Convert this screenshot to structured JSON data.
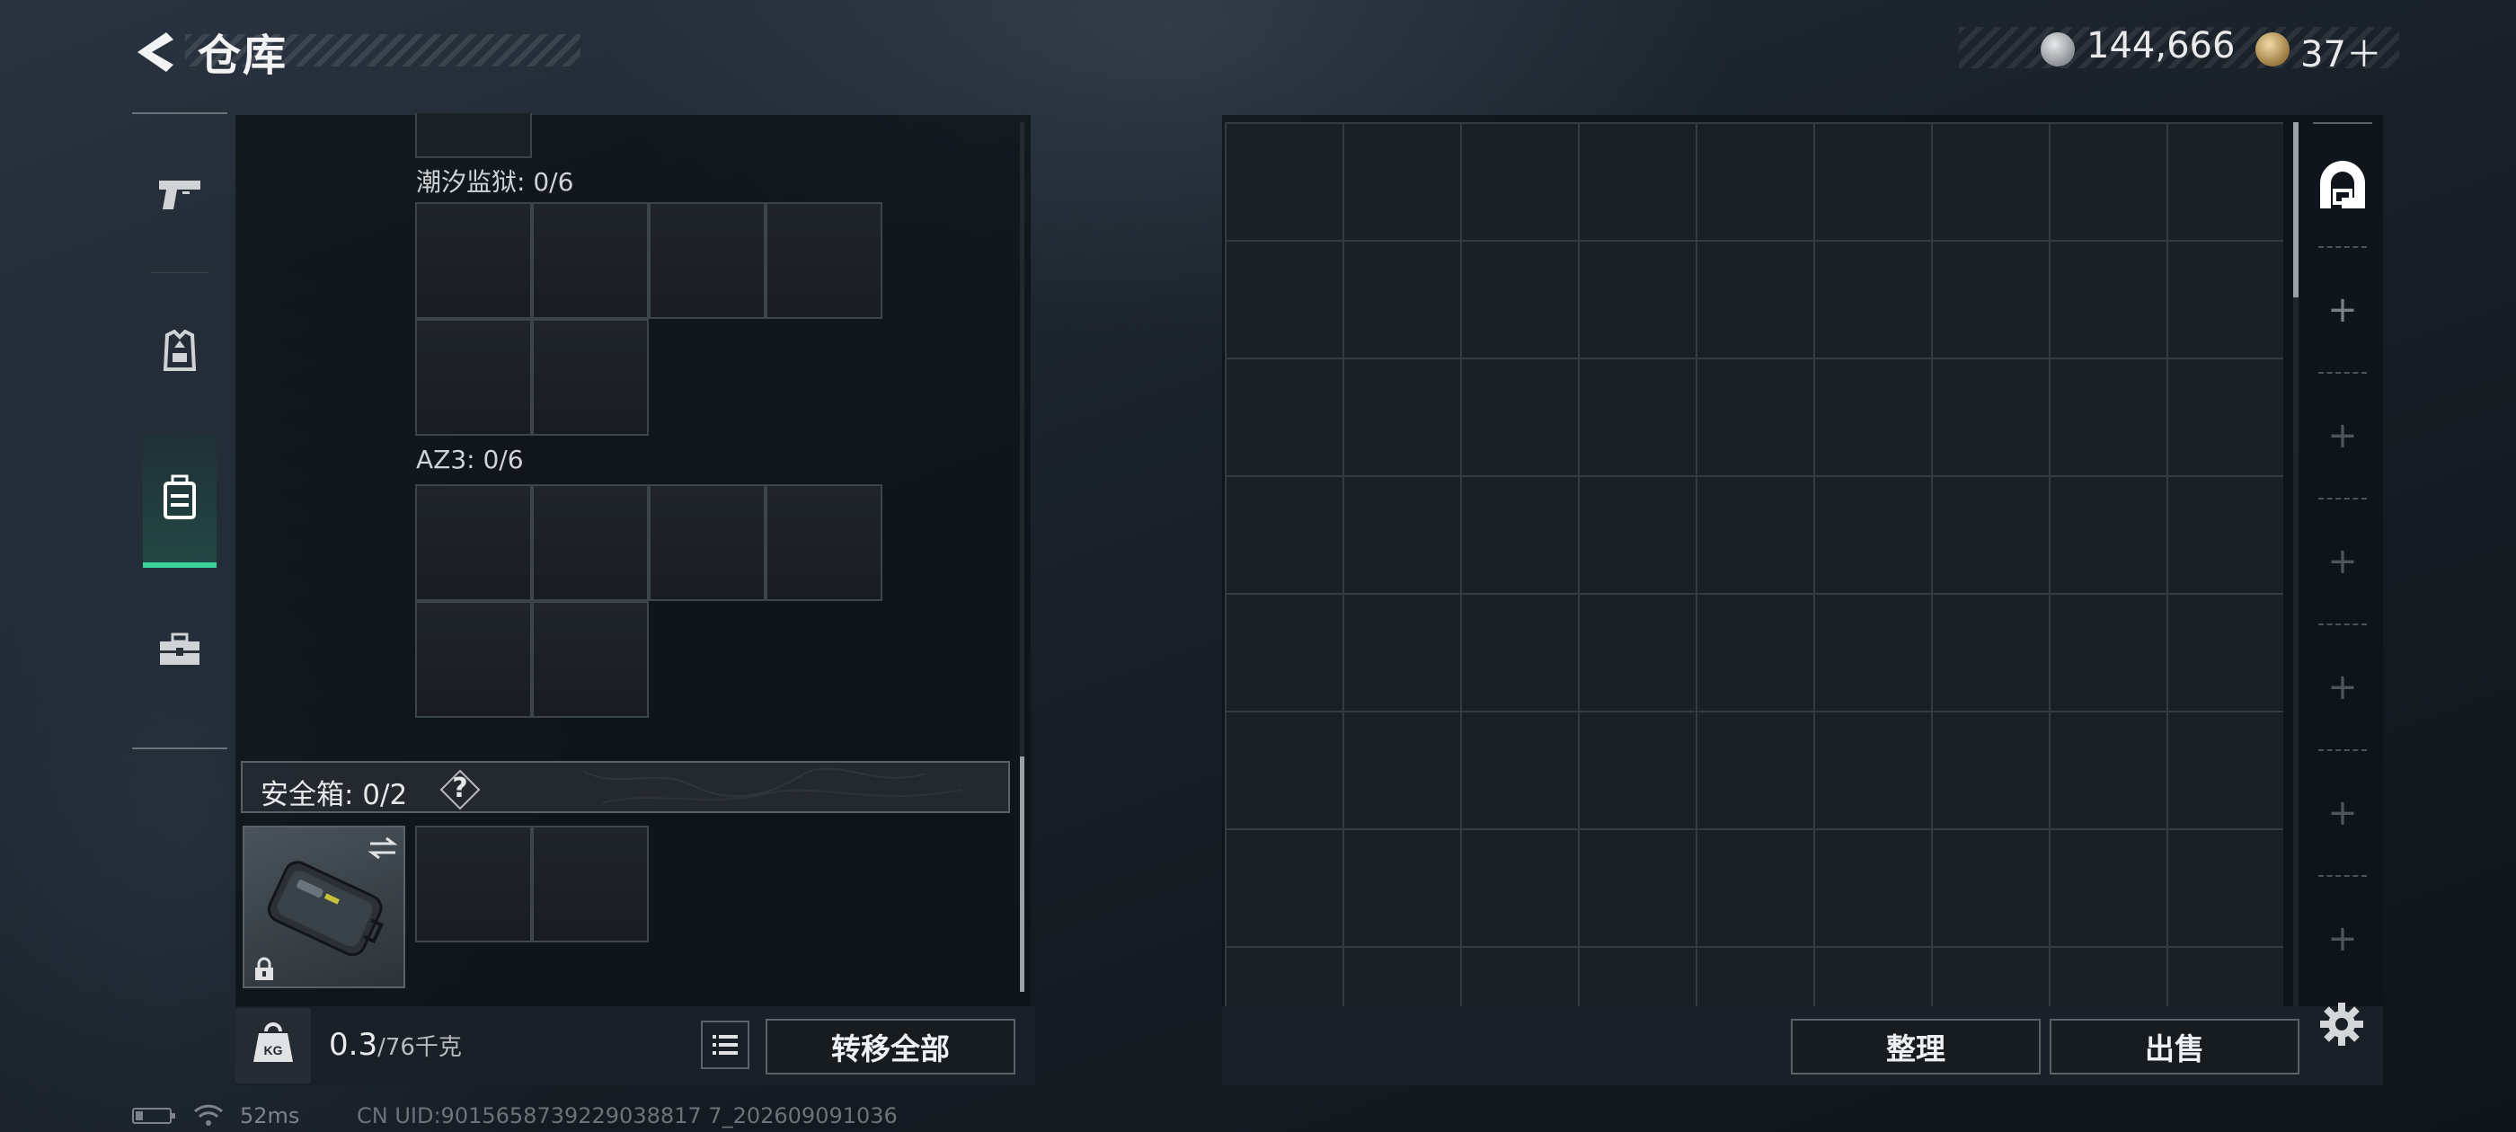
{
  "header": {
    "title": "仓库",
    "back_icon": "chevron-left-icon"
  },
  "currency": [
    {
      "icon": "silver-coin-icon",
      "value": "144,666"
    },
    {
      "icon": "gold-coin-icon",
      "value": "37＋"
    }
  ],
  "sidebar": {
    "items": [
      {
        "name": "weapons",
        "icon": "pistol-icon",
        "selected": false
      },
      {
        "name": "armor",
        "icon": "vest-icon",
        "selected": false
      },
      {
        "name": "backpack",
        "icon": "backpack-icon",
        "selected": true
      },
      {
        "name": "tools",
        "icon": "toolbox-icon",
        "selected": false
      }
    ],
    "selected_color": "#3ad29b"
  },
  "containers": [
    {
      "label": "潮汐监狱: 0/6",
      "slots": 6
    },
    {
      "label": "AZ3: 0/6",
      "slots": 6
    }
  ],
  "safe_box": {
    "label": "安全箱: 0/2",
    "help": "?",
    "slots": 2,
    "locked": true
  },
  "weight": {
    "current": "0.3",
    "capacity": "/76千克",
    "icon": "kg-weight-icon"
  },
  "buttons": {
    "transfer_all": "转移全部",
    "tidy": "整理",
    "sell": "出售",
    "list_icon": "list-icon",
    "settings_icon": "gear-icon"
  },
  "stash_tabs": [
    {
      "icon": "stash-home-icon",
      "selected": true
    },
    {
      "icon": "plus-icon"
    },
    {
      "icon": "plus-icon"
    },
    {
      "icon": "plus-icon"
    },
    {
      "icon": "plus-icon"
    },
    {
      "icon": "plus-icon"
    },
    {
      "icon": "plus-icon"
    }
  ],
  "status": {
    "ping": "52ms",
    "uid": "CN UID:9015658739229038817 7_202609091036"
  }
}
